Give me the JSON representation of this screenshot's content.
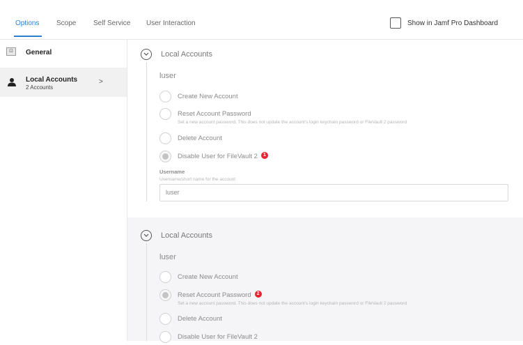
{
  "tabs": [
    {
      "label": "Options",
      "active": true
    },
    {
      "label": "Scope",
      "active": false
    },
    {
      "label": "Self Service",
      "active": false
    },
    {
      "label": "User Interaction",
      "active": false
    }
  ],
  "dashboard_toggle": {
    "label": "Show in Jamf Pro Dashboard",
    "checked": false
  },
  "sidebar": {
    "items": [
      {
        "title": "General",
        "icon": "general-payload-icon"
      },
      {
        "title": "Local Accounts",
        "subtitle": "2 Accounts",
        "icon": "user-icon",
        "selected": true
      }
    ]
  },
  "sections": [
    {
      "title": "Local Accounts",
      "account": "luser",
      "options": [
        {
          "label": "Create New Account",
          "selected": false
        },
        {
          "label": "Reset Account Password",
          "description": "Set a new account password. This does not update the account's login keychain password or FileVault 2 password",
          "selected": false
        },
        {
          "label": "Delete Account",
          "selected": false
        },
        {
          "label": "Disable User for FileVault 2",
          "selected": true,
          "badge": "1"
        }
      ],
      "username": {
        "label": "Username",
        "hint": "Username/short name for the account",
        "value": "luser"
      }
    },
    {
      "title": "Local Accounts",
      "account": "luser",
      "options": [
        {
          "label": "Create New Account",
          "selected": false
        },
        {
          "label": "Reset Account Password",
          "description": "Set a new account password. This does not update the account's login keychain password or FileVault 2 password",
          "selected": true,
          "badge": "2"
        },
        {
          "label": "Delete Account",
          "selected": false
        },
        {
          "label": "Disable User for FileVault 2",
          "selected": false
        }
      ]
    }
  ],
  "colors": {
    "accent": "#2a7fd4",
    "badge": "#e4242f"
  }
}
